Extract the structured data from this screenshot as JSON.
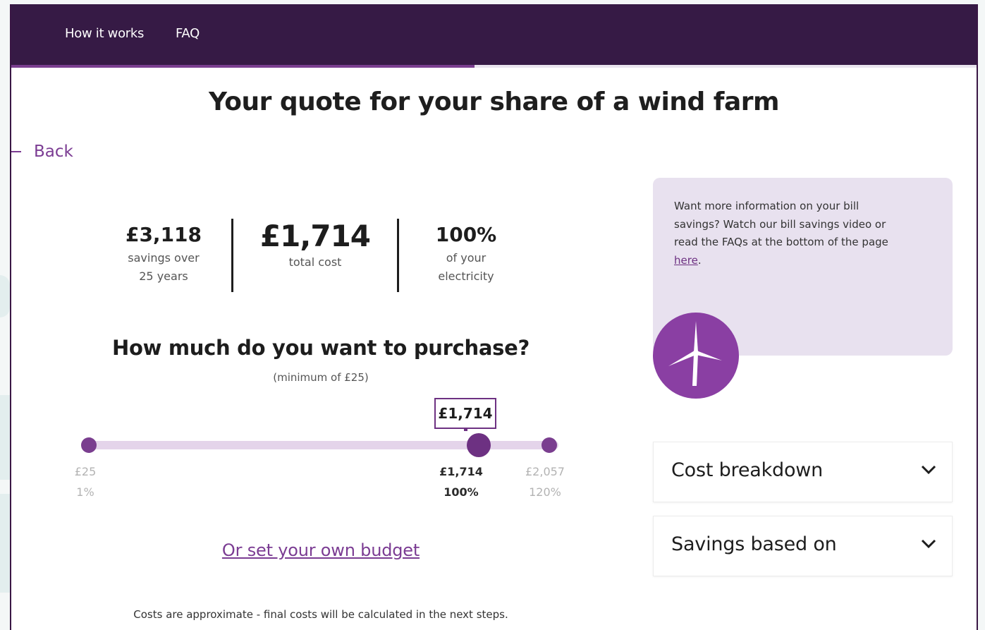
{
  "nav": {
    "how_it_works": "How it works",
    "faq": "FAQ"
  },
  "progress_fraction": 0.48,
  "page_title": "Your quote for your share of a wind farm",
  "back_label": "Back",
  "stats": {
    "savings": {
      "value": "£3,118",
      "label_line1": "savings over",
      "label_line2": "25 years"
    },
    "total": {
      "value": "£1,714",
      "label": "total cost"
    },
    "electricity": {
      "value": "100%",
      "label_line1": "of your",
      "label_line2": "electricity"
    }
  },
  "purchase": {
    "question": "How much do you want to purchase?",
    "hint": "(minimum of £25)",
    "current_value": "£1,714",
    "current_fraction": 0.83,
    "ticks": [
      {
        "amount": "£25",
        "percent": "1%"
      },
      {
        "amount": "£1,714",
        "percent": "100%"
      },
      {
        "amount": "£2,057",
        "percent": "120%"
      }
    ]
  },
  "own_budget_link": "Or set your own budget",
  "disclaimer": "Costs are approximate - final costs will be calculated in the next steps.",
  "info": {
    "line1": "Want more information on your bill",
    "line2": "savings? Watch our bill savings video or",
    "line3": "read the FAQs at the bottom of the page",
    "link": "here",
    "link_suffix": "."
  },
  "accordions": {
    "cost_breakdown": "Cost breakdown",
    "savings_based_on": "Savings based on"
  },
  "colors": {
    "nav_bg": "#361a45",
    "accent": "#7a3e8f",
    "info_bg": "#e8e1ef"
  }
}
